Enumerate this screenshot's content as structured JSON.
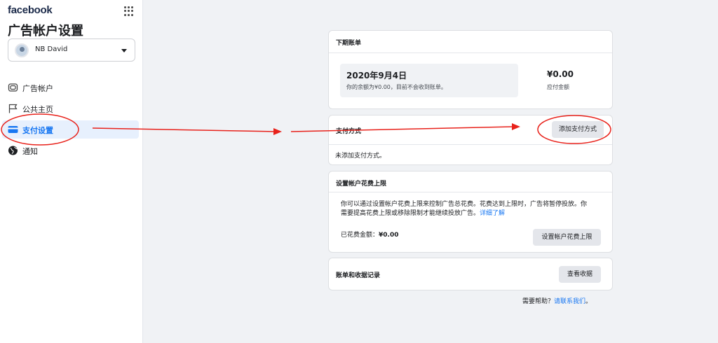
{
  "brand": "facebook",
  "page_title": "广告帐户设置",
  "account": {
    "name": "NB David"
  },
  "nav": [
    {
      "label": "广告帐户",
      "icon": "ad-account-icon"
    },
    {
      "label": "公共主页",
      "icon": "flag-icon"
    },
    {
      "label": "支付设置",
      "icon": "credit-card-icon",
      "active": true
    },
    {
      "label": "通知",
      "icon": "globe-icon"
    }
  ],
  "next_bill": {
    "title": "下期账单",
    "date": "2020年9月4日",
    "note": "你的余额为¥0.00，目前不会收到账单。",
    "amount": "¥0.00",
    "amount_label": "应付金额"
  },
  "payment": {
    "title": "支付方式",
    "add_button": "添加支付方式",
    "empty": "未添加支付方式。"
  },
  "spend_limit": {
    "title": "设置帐户花费上限",
    "description_line1": "你可以通过设置帐户花费上限来控制广告总花费。花费达到上限时，广告将暂停投放。你",
    "description_line2": "需要提高花费上限或移除限制才能继续投放广告。",
    "learn_more": "详细了解",
    "spent_label": "已花费金额：",
    "spent_value": "¥0.00",
    "button": "设置帐户花费上限"
  },
  "billing": {
    "title": "账单和收据记录",
    "button": "查看收据"
  },
  "help": {
    "text": "需要帮助？",
    "link": "请联系我们",
    "suffix": "。"
  },
  "annotation_color": "#e8221b",
  "accent_color": "#1877f2"
}
